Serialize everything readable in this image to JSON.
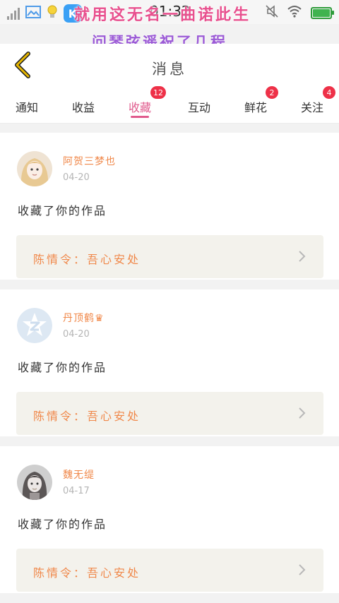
{
  "status_bar": {
    "time": "01:32",
    "app_icon_letter": "K",
    "icons": [
      "signal-icon",
      "image-icon",
      "lightbulb-icon",
      "app-k-icon",
      "mute-icon",
      "wifi-icon",
      "battery-icon"
    ]
  },
  "overlay": {
    "line1": "就用这无名一曲诺此生",
    "line2": "问琴弦遥祝了几程"
  },
  "header": {
    "title": "消息",
    "back_icon": "chevron-left-icon"
  },
  "tabs": [
    {
      "label": "通知",
      "badge": ""
    },
    {
      "label": "收益",
      "badge": ""
    },
    {
      "label": "收藏",
      "badge": "12",
      "active": true
    },
    {
      "label": "互动",
      "badge": ""
    },
    {
      "label": "鲜花",
      "badge": "2"
    },
    {
      "label": "关注",
      "badge": "4"
    }
  ],
  "items": [
    {
      "user": "阿贺三梦也",
      "date": "04-20",
      "message": "收藏了你的作品",
      "work": "陈情令：吾心安处"
    },
    {
      "user": "丹顶鹤♛",
      "date": "04-20",
      "message": "收藏了你的作品",
      "work": "陈情令：吾心安处"
    },
    {
      "user": "魏无缇",
      "date": "04-17",
      "message": "收藏了你的作品",
      "work": "陈情令：吾心安处"
    }
  ],
  "colors": {
    "accent": "#e05a8d",
    "badge": "#ee3148",
    "username": "#f0884a",
    "back_arrow": "#e8b800",
    "work_box_bg": "#f3f2ec"
  }
}
